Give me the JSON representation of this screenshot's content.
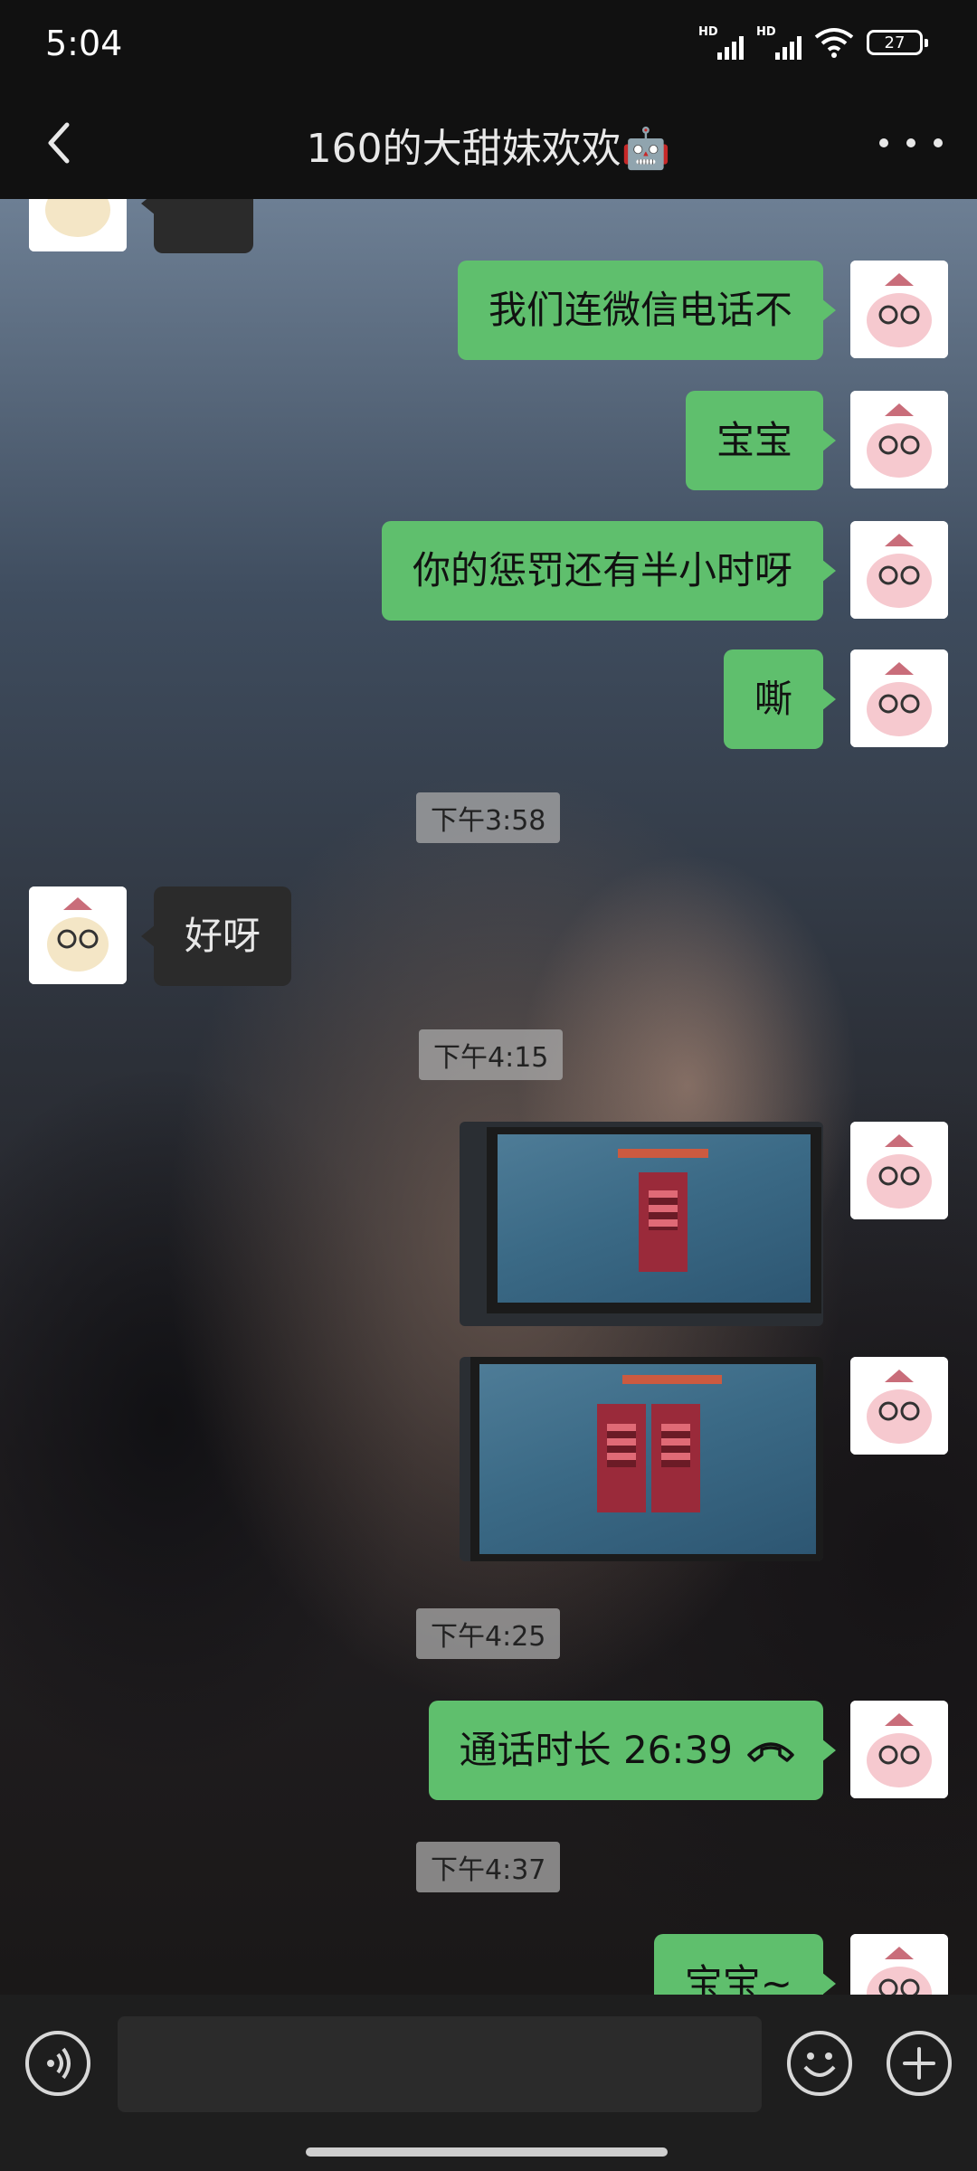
{
  "status": {
    "time": "5:04",
    "signal1_label": "HD",
    "signal2_label": "HD",
    "battery": "27",
    "icons": [
      "signal-icon",
      "signal-icon",
      "wifi-icon",
      "battery-icon"
    ]
  },
  "header": {
    "title": "160的大甜妹欢欢🤖",
    "back_icon": "chevron-left-icon",
    "more_icon": "more-dots-icon"
  },
  "messages": {
    "m1": "我们连微信电话不",
    "m2": "宝宝",
    "m3": "你的惩罚还有半小时呀",
    "m4": "嘶",
    "t1": "下午3:58",
    "m5": "好呀",
    "t2": "下午4:15",
    "t3": "下午4:25",
    "m6": "通话时长 26:39",
    "t4": "下午4:37",
    "m7": "宝宝~"
  },
  "input_bar": {
    "voice_icon": "voice-icon",
    "emoji_icon": "emoji-icon",
    "plus_icon": "plus-icon"
  },
  "colors": {
    "outgoing_bubble": "#5fbf6d",
    "incoming_bubble": "#2b2b2b",
    "bar_background": "#111111"
  }
}
